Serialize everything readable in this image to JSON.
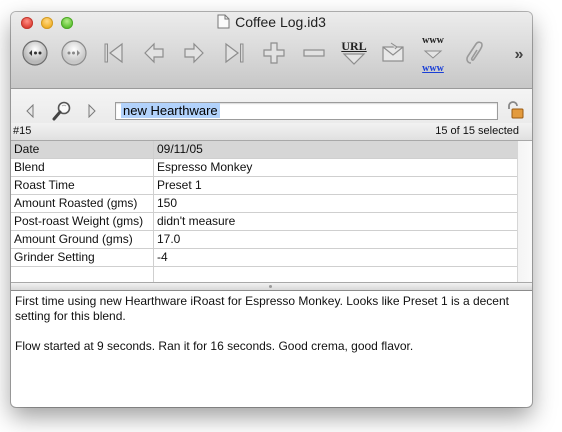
{
  "window": {
    "title": "Coffee Log.id3"
  },
  "toolbar": {
    "buttons": [
      {
        "name": "back-record-icon"
      },
      {
        "name": "forward-record-icon"
      },
      {
        "name": "first-record-icon"
      },
      {
        "name": "previous-record-icon"
      },
      {
        "name": "next-record-icon"
      },
      {
        "name": "last-record-icon"
      },
      {
        "name": "add-record-icon"
      },
      {
        "name": "delete-record-icon"
      },
      {
        "name": "url-icon",
        "label": "URL"
      },
      {
        "name": "mail-icon"
      },
      {
        "name": "web-icon",
        "label_top": "www",
        "label_bottom": "www"
      },
      {
        "name": "attachment-icon"
      },
      {
        "name": "overflow-icon",
        "label": "»"
      }
    ]
  },
  "search": {
    "value": "new Hearthware"
  },
  "status": {
    "record_number": "#15",
    "selection": "15 of 15 selected"
  },
  "fields": [
    {
      "label": "Date",
      "value": "09/11/05"
    },
    {
      "label": "Blend",
      "value": "Espresso Monkey"
    },
    {
      "label": "Roast Time",
      "value": "Preset 1"
    },
    {
      "label": "Amount Roasted (gms)",
      "value": "150"
    },
    {
      "label": "Post-roast Weight (gms)",
      "value": "didn't measure"
    },
    {
      "label": "Amount Ground (gms)",
      "value": "17.0"
    },
    {
      "label": "Grinder Setting",
      "value": "-4"
    },
    {
      "label": "",
      "value": ""
    }
  ],
  "notes": {
    "line1": "First time using new Hearthware iRoast for Espresso Monkey. Looks like Preset 1 is a decent setting for this blend.",
    "line2": "Flow started at 9 seconds. Ran it for 16 seconds. Good crema, good flavor."
  }
}
